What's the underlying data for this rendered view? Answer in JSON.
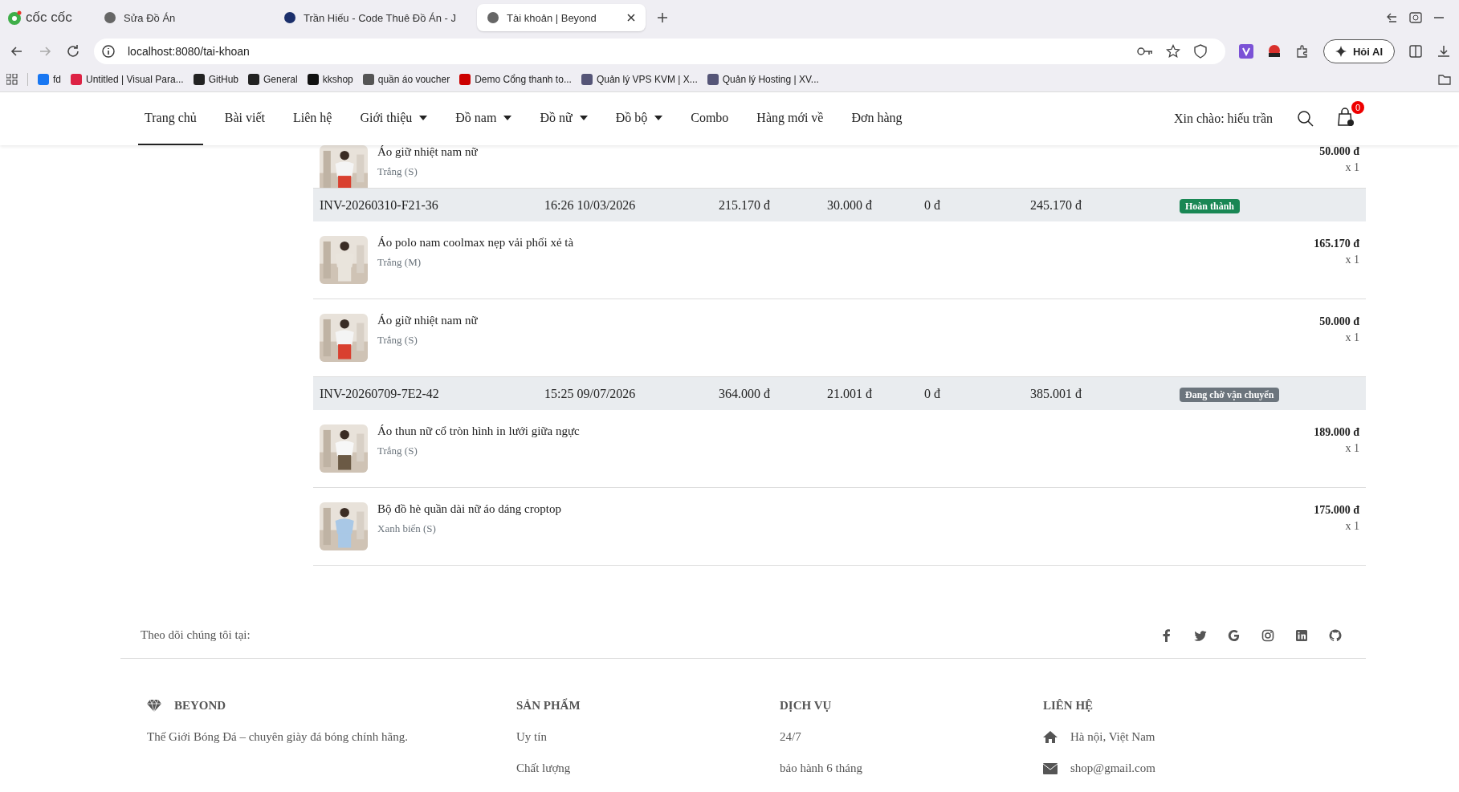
{
  "browser": {
    "brand": "cốc cốc",
    "tabs": [
      {
        "title": "Sửa Đồ Án",
        "selected": false
      },
      {
        "title": "Trần Hiếu - Code Thuê Đồ Án - J",
        "selected": false
      },
      {
        "title": "Tài khoản | Beyond",
        "selected": true
      }
    ],
    "address": "localhost:8080/tai-khoan",
    "ask_ai": "Hỏi AI",
    "bookmarks": [
      "fd",
      "Untitled | Visual Para...",
      "GitHub",
      "General",
      "kkshop",
      "quần áo voucher",
      "Demo Cổng thanh to...",
      "Quản lý VPS KVM | X...",
      "Quản lý Hosting | XV..."
    ]
  },
  "nav": {
    "items": [
      {
        "label": "Trang chủ",
        "selected": true,
        "dropdown": false
      },
      {
        "label": "Bài viết",
        "selected": false,
        "dropdown": false
      },
      {
        "label": "Liên hệ",
        "selected": false,
        "dropdown": false
      },
      {
        "label": "Giới thiệu",
        "selected": false,
        "dropdown": true
      },
      {
        "label": "Đồ nam",
        "selected": false,
        "dropdown": true
      },
      {
        "label": "Đồ nữ",
        "selected": false,
        "dropdown": true
      },
      {
        "label": "Đồ bộ",
        "selected": false,
        "dropdown": true
      },
      {
        "label": "Combo",
        "selected": false,
        "dropdown": false
      },
      {
        "label": "Hàng mới về",
        "selected": false,
        "dropdown": false
      },
      {
        "label": "Đơn hàng",
        "selected": false,
        "dropdown": false
      }
    ],
    "greeting": "Xin chào: hiếu trần",
    "cart_count": "0"
  },
  "orders": [
    {
      "kind": "product",
      "name": "Áo giữ nhiệt nam nữ",
      "variant": "Trắng (S)",
      "price": "50.000 đ",
      "qty": "x 1"
    },
    {
      "kind": "order",
      "code": "INV-20260310-F21-36",
      "time": "16:26 10/03/2026",
      "subtotal": "215.170 đ",
      "shipping": "30.000 đ",
      "discount": "0 đ",
      "total": "245.170 đ",
      "status": "Hoàn thành",
      "color": "#198754"
    },
    {
      "kind": "product",
      "name": "Áo polo nam coolmax nẹp vải phối xẻ tà",
      "variant": "Trắng (M)",
      "price": "165.170 đ",
      "qty": "x 1"
    },
    {
      "kind": "product",
      "name": "Áo giữ nhiệt nam nữ",
      "variant": "Trắng (S)",
      "price": "50.000 đ",
      "qty": "x 1"
    },
    {
      "kind": "order",
      "code": "INV-20260709-7E2-42",
      "time": "15:25 09/07/2026",
      "subtotal": "364.000 đ",
      "shipping": "21.001 đ",
      "discount": "0 đ",
      "total": "385.001 đ",
      "status": "Đang chờ vận chuyển",
      "color": "#6c757d"
    },
    {
      "kind": "product",
      "name": "Áo thun nữ cổ tròn hình in lưới giữa ngực",
      "variant": "Trắng (S)",
      "price": "189.000 đ",
      "qty": "x 1"
    },
    {
      "kind": "product",
      "name": "Bộ đồ hè quần dài nữ áo dáng croptop",
      "variant": "Xanh biển (S)",
      "price": "175.000 đ",
      "qty": "x 1"
    }
  ],
  "footer": {
    "follow": "Theo dõi chúng tôi tại:",
    "brand": "BEYOND",
    "tagline": "Thế Giới Bóng Đá – chuyên giày đá bóng chính hãng.",
    "columns": [
      {
        "title": "SẢN PHẨM",
        "links": [
          "Uy tín",
          "Chất lượng"
        ]
      },
      {
        "title": "DỊCH VỤ",
        "links": [
          "24/7",
          "bảo hành 6 tháng"
        ]
      }
    ],
    "contact": {
      "title": "LIÊN HỆ",
      "address": "Hà nội, Việt Nam",
      "email": "shop@gmail.com"
    }
  }
}
